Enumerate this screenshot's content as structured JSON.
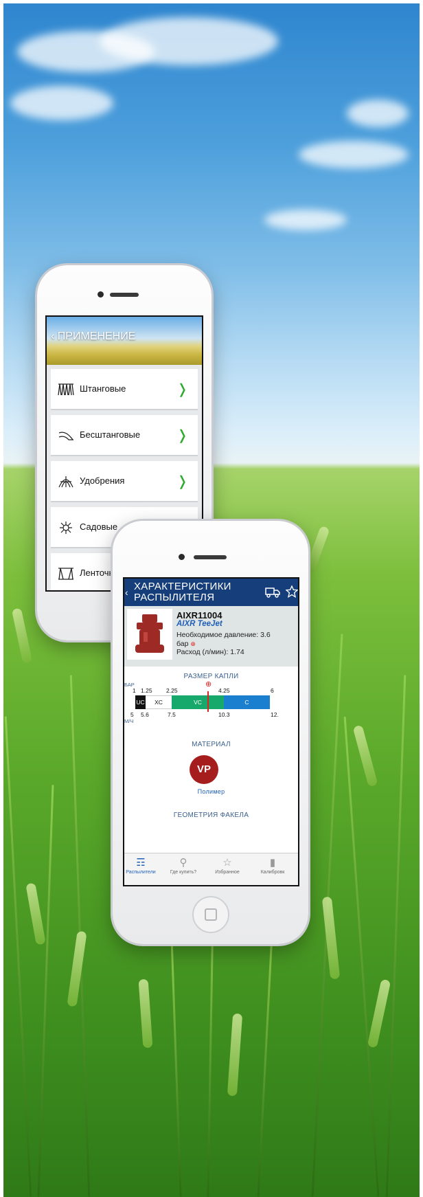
{
  "back_phone": {
    "header_title": "ПРИМЕНЕНИЕ",
    "items": [
      {
        "label": "Штанговые",
        "icon": "boom-sprayer-icon"
      },
      {
        "label": "Бесштанговые",
        "icon": "boomless-sprayer-icon"
      },
      {
        "label": "Удобрения",
        "icon": "fertilizer-icon"
      },
      {
        "label": "Садовые",
        "icon": "orchard-icon"
      },
      {
        "label": "Ленточн",
        "icon": "band-spray-icon"
      }
    ]
  },
  "front_phone": {
    "header_title_line1": "ХАРАКТЕРИСТИКИ",
    "header_title_line2": "РАСПЫЛИТЕЛЯ",
    "product": {
      "id": "AIXR11004",
      "brand": "AIXR TeeJet",
      "pressure_label": "Необходимое давление: 3.6",
      "pressure_unit": "бар",
      "flow_label": "Расход (л/мин): 1.74"
    },
    "droplet_section_title": "РАЗМЕР КАПЛИ",
    "pressure_axis_unit": "БАР",
    "speed_axis_unit": "М/Ч",
    "pressure_ticks": [
      "1",
      "1.25",
      "2.25",
      "4.25",
      "6"
    ],
    "speed_ticks": [
      "5",
      "5.6",
      "7.5",
      "10.3",
      "12."
    ],
    "droplet_classes": [
      {
        "code": "UC",
        "color": "#111111"
      },
      {
        "code": "XC",
        "color": "#ffffff"
      },
      {
        "code": "VC",
        "color": "#17a86b"
      },
      {
        "code": "C",
        "color": "#1a7fcf"
      }
    ],
    "material_section_title": "МАТЕРИАЛ",
    "material_badge": "VP",
    "material_name": "Полимер",
    "geometry_section_title": "ГЕОМЕТРИЯ ФАКЕЛА",
    "tabs": [
      {
        "label": "Распылители",
        "icon": "nozzle-icon",
        "active": true
      },
      {
        "label": "Где купить?",
        "icon": "location-pin-icon",
        "active": false
      },
      {
        "label": "Избранное",
        "icon": "star-icon",
        "active": false
      },
      {
        "label": "Калибровк",
        "icon": "calibration-icon",
        "active": false
      }
    ]
  }
}
